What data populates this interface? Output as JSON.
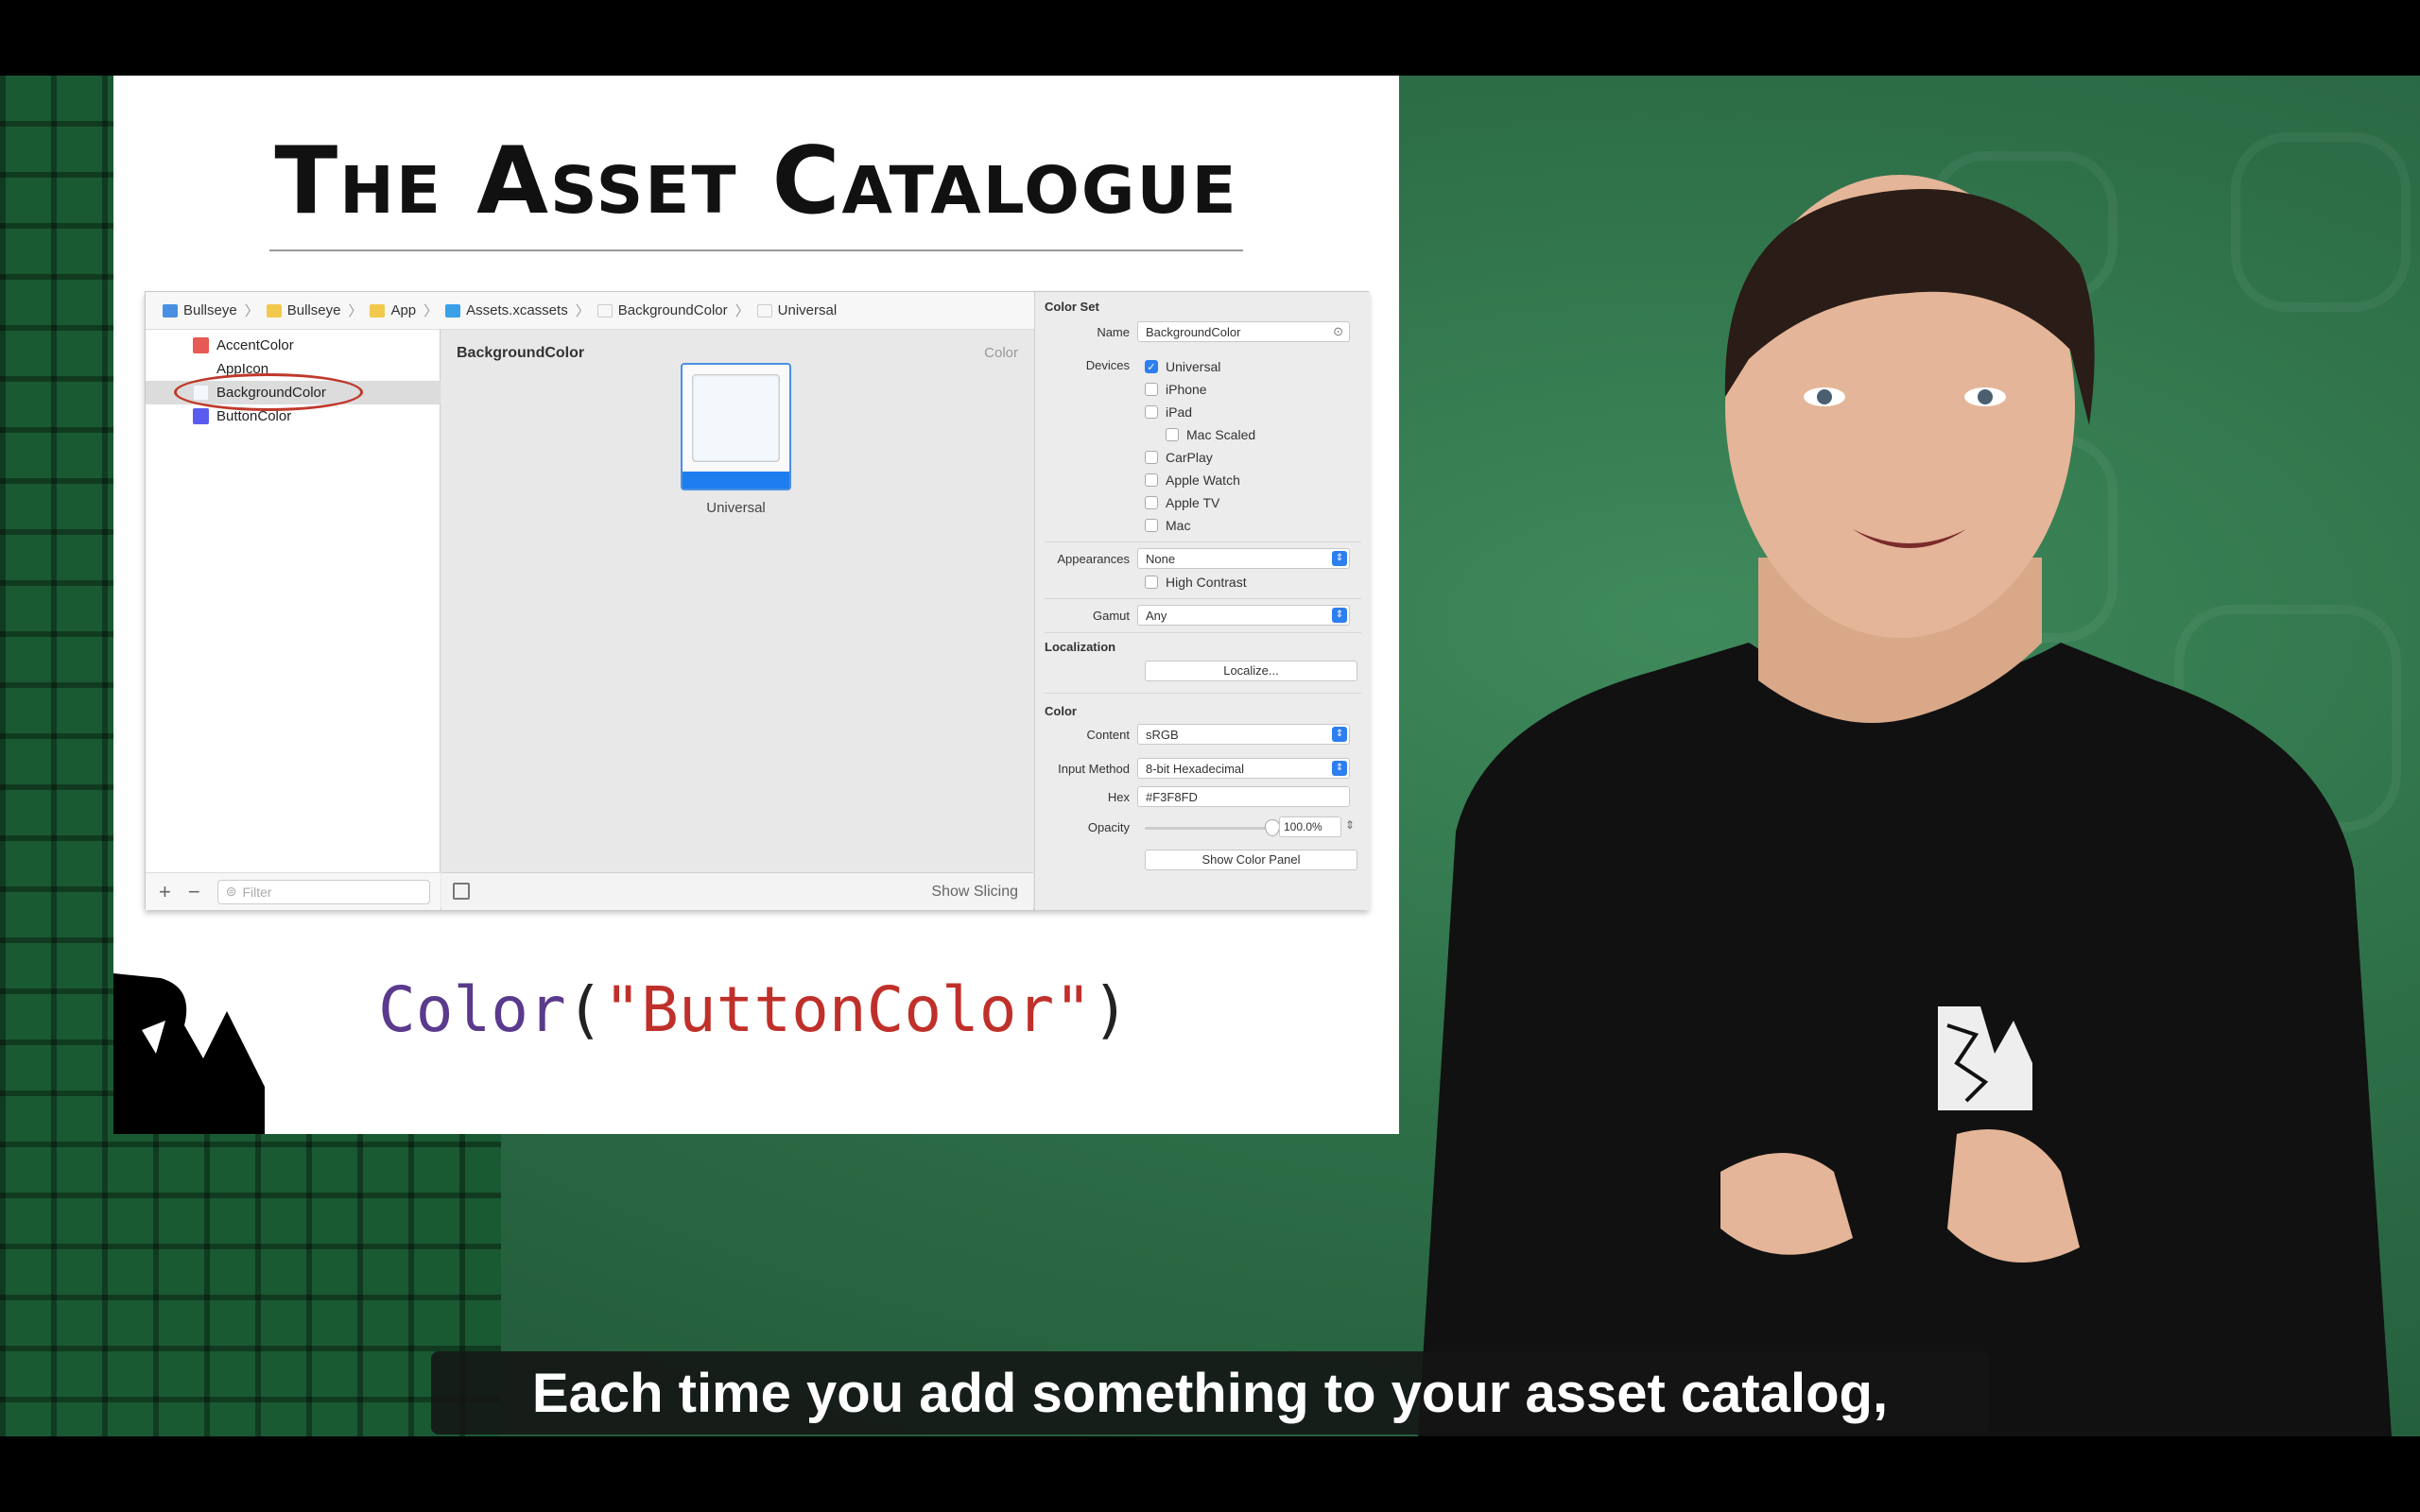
{
  "slide": {
    "title": "The Asset Catalogue",
    "code": {
      "type": "Color",
      "open": "(",
      "string": "\"ButtonColor\"",
      "close": ")"
    }
  },
  "xcode": {
    "breadcrumb": [
      "Bullseye",
      "Bullseye",
      "App",
      "Assets.xcassets",
      "BackgroundColor",
      "Universal"
    ],
    "assets": [
      {
        "name": "AccentColor",
        "color": "#e85a54"
      },
      {
        "name": "AppIcon",
        "color": "#ffffff"
      },
      {
        "name": "BackgroundColor",
        "color": "#F3F8FD"
      },
      {
        "name": "ButtonColor",
        "color": "#5a5cf0"
      }
    ],
    "selected_asset": "BackgroundColor",
    "filter_placeholder": "Filter",
    "editor": {
      "title": "BackgroundColor",
      "type": "Color",
      "well_label": "Universal",
      "show_slicing": "Show Slicing"
    },
    "inspector": {
      "color_set_header": "Color Set",
      "name_label": "Name",
      "name_value": "BackgroundColor",
      "devices_label": "Devices",
      "devices": [
        {
          "label": "Universal",
          "checked": true
        },
        {
          "label": "iPhone",
          "checked": false
        },
        {
          "label": "iPad",
          "checked": false
        },
        {
          "label": "Mac Scaled",
          "checked": false
        },
        {
          "label": "CarPlay",
          "checked": false
        },
        {
          "label": "Apple Watch",
          "checked": false
        },
        {
          "label": "Apple TV",
          "checked": false
        },
        {
          "label": "Mac",
          "checked": false
        }
      ],
      "appearances_label": "Appearances",
      "appearances_value": "None",
      "high_contrast": "High Contrast",
      "gamut_label": "Gamut",
      "gamut_value": "Any",
      "localization_header": "Localization",
      "localize_button": "Localize...",
      "color_header": "Color",
      "content_label": "Content",
      "content_value": "sRGB",
      "input_method_label": "Input Method",
      "input_method_value": "8-bit Hexadecimal",
      "hex_label": "Hex",
      "hex_value": "#F3F8FD",
      "opacity_label": "Opacity",
      "opacity_value": "100.0%",
      "opacity_level": 1.0,
      "show_color_panel": "Show Color Panel"
    }
  },
  "subtitle": "Each time you add something to your asset catalog,",
  "colors": {
    "background_green": "#2d6e47",
    "accent_blue": "#2d7ff0",
    "code_type": "#5a3a8c",
    "code_string": "#c0302a"
  }
}
